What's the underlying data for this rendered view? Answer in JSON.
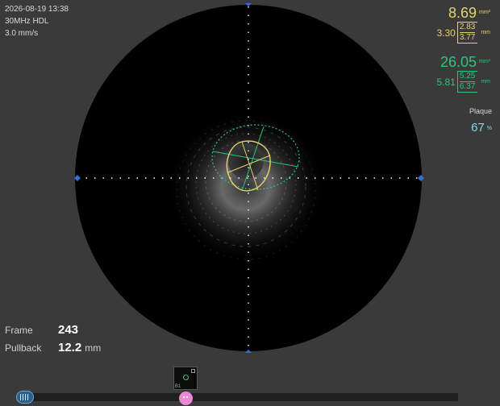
{
  "header": {
    "datetime": "2026-08-19 13:38",
    "probe": "30MHz HDL",
    "speed": "3.0 mm/s"
  },
  "lumen": {
    "area": "8.69",
    "area_unit": "mm²",
    "mean_diameter": "3.30",
    "min_diameter": "2.83",
    "max_diameter": "3.77",
    "diameter_unit": "mm",
    "color": "#e6d36c"
  },
  "vessel": {
    "area": "26.05",
    "area_unit": "mm²",
    "mean_diameter": "5.81",
    "min_diameter": "5.25",
    "max_diameter": "6.37",
    "diameter_unit": "mm",
    "color": "#2bc483"
  },
  "plaque": {
    "label": "Plaque",
    "value": "67",
    "unit": "%",
    "color": "#7fd7e8"
  },
  "frame": {
    "label": "Frame",
    "value": "243"
  },
  "pullback": {
    "label": "Pullback",
    "value": "12.2",
    "unit": "mm"
  },
  "bookmark": {
    "label": "B1"
  },
  "icons": {
    "timeline_handle": "film-strip-icon",
    "position_marker": "playhead-icon",
    "delete": "trash-icon"
  }
}
